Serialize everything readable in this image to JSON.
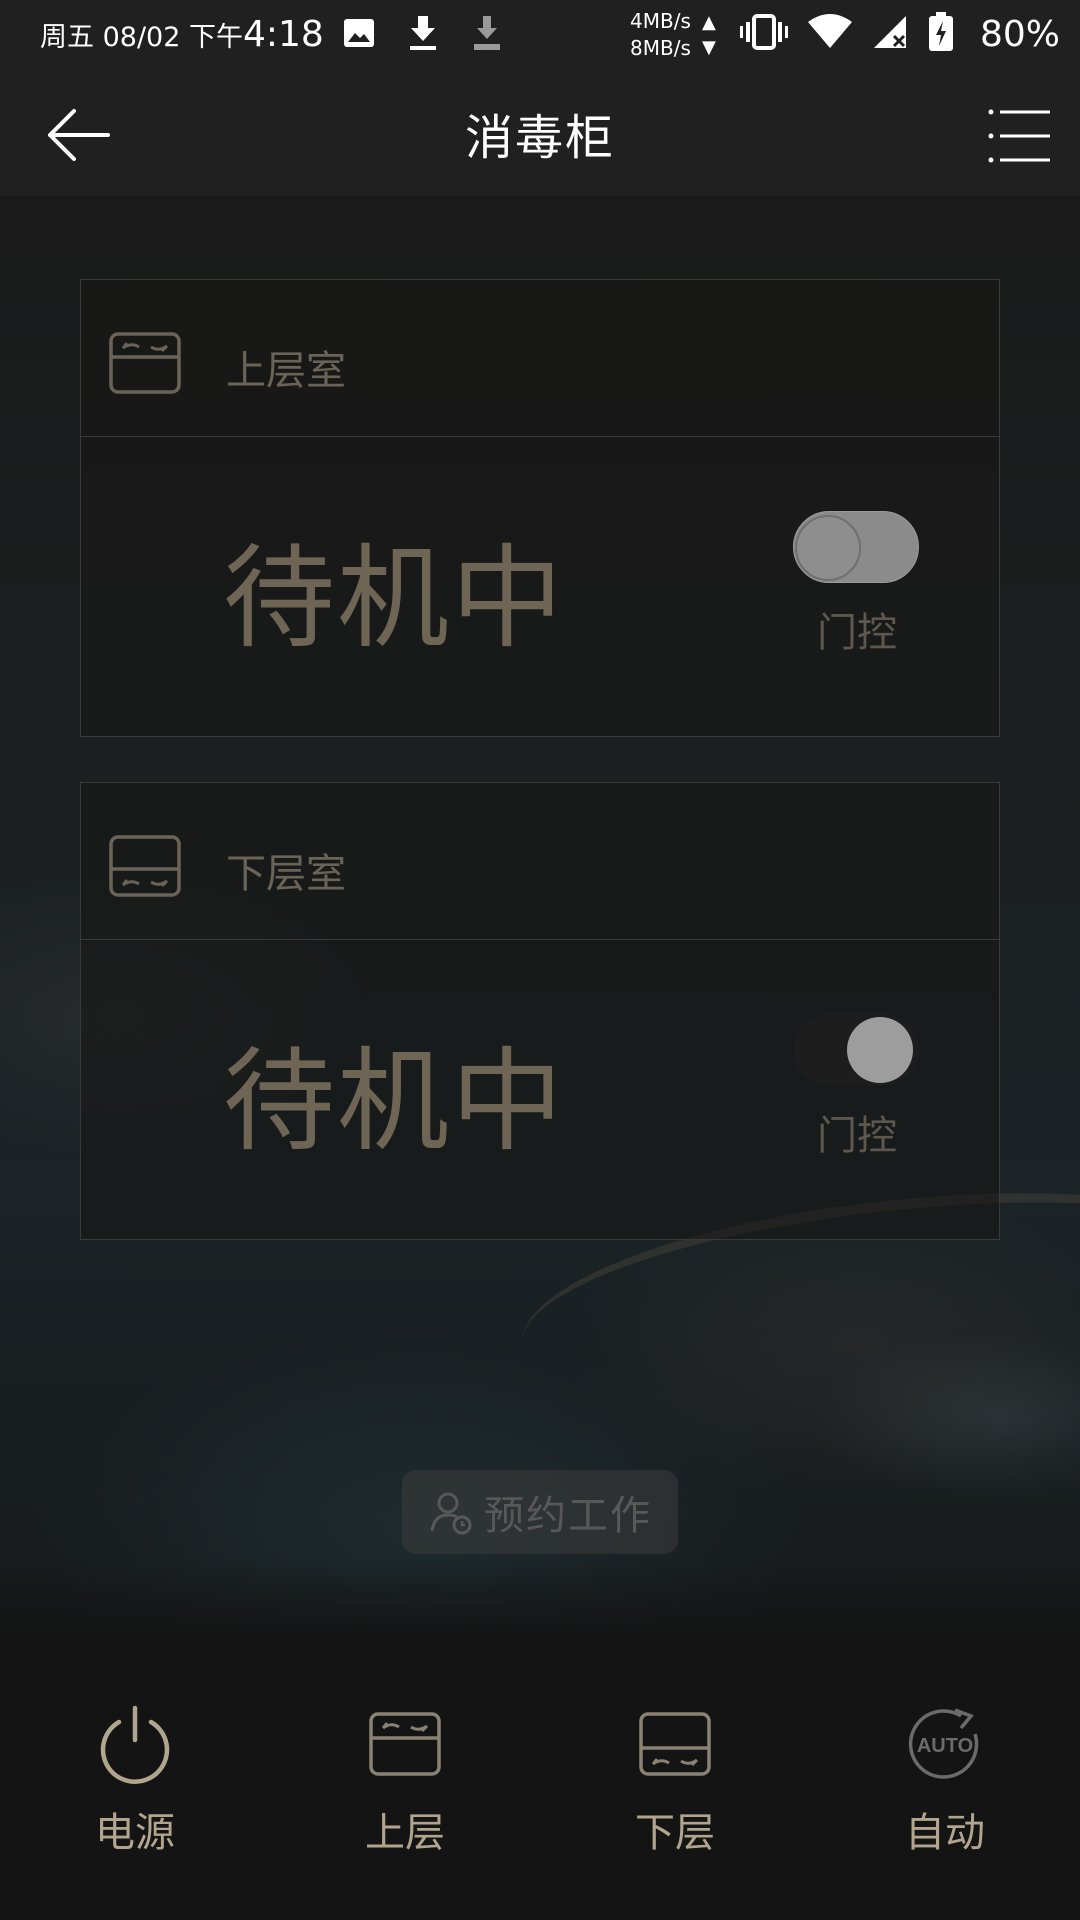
{
  "status_bar": {
    "date": "周五 08/02 下午",
    "time": "4:18",
    "speed_up": "4MB/s",
    "speed_down": "8MB/s",
    "battery": "80%",
    "icons": [
      "image-icon",
      "download-icon",
      "download-pending-icon",
      "data-arrows-icon",
      "vibrate-icon",
      "wifi-icon",
      "signal-no-service-icon",
      "battery-charging-icon"
    ]
  },
  "header": {
    "title": "消毒柜",
    "back_icon": "arrow-left-icon",
    "menu_icon": "list-menu-icon"
  },
  "chambers": [
    {
      "label": "上层室",
      "status": "待机中",
      "door_control_label": "门控",
      "door_control_state": "off"
    },
    {
      "label": "下层室",
      "status": "待机中",
      "door_control_label": "门控",
      "door_control_state": "dark"
    }
  ],
  "schedule": {
    "label": "预约工作",
    "icon": "user-clock-icon"
  },
  "bottom_nav": [
    {
      "label": "电源",
      "icon": "power-icon"
    },
    {
      "label": "上层",
      "icon": "upper-chamber-icon"
    },
    {
      "label": "下层",
      "icon": "lower-chamber-icon"
    },
    {
      "label": "自动",
      "icon": "auto-cycle-icon"
    }
  ],
  "colors": {
    "accent": "#b1a58e",
    "status_text": "#6e6555",
    "header_bg": "#202020",
    "page_bg": "#141414"
  }
}
